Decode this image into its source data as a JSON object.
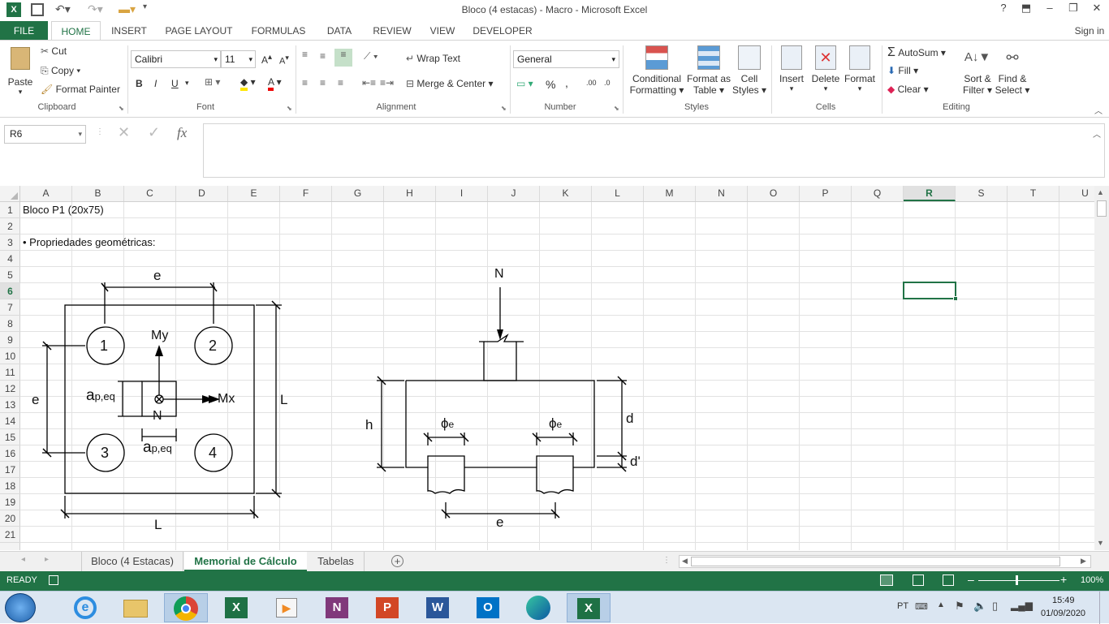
{
  "window": {
    "title": "Bloco (4 estacas) - Macro - Microsoft Excel",
    "help": "?",
    "sign_in": "Sign in"
  },
  "tabs": [
    "FILE",
    "HOME",
    "INSERT",
    "PAGE LAYOUT",
    "FORMULAS",
    "DATA",
    "REVIEW",
    "VIEW",
    "DEVELOPER"
  ],
  "ribbon": {
    "clipboard": {
      "paste": "Paste",
      "cut": "Cut",
      "copy": "Copy",
      "format_painter": "Format Painter",
      "label": "Clipboard"
    },
    "font": {
      "name": "Calibri",
      "size": "11",
      "label": "Font",
      "bold": "B",
      "italic": "I",
      "underline": "U"
    },
    "alignment": {
      "wrap": "Wrap Text",
      "merge": "Merge & Center",
      "label": "Alignment"
    },
    "number": {
      "format": "General",
      "label": "Number",
      "percent": "%",
      "comma": ","
    },
    "styles": {
      "conditional": "Conditional",
      "conditional2": "Formatting",
      "format_table": "Format as",
      "format_table2": "Table",
      "cell_styles": "Cell",
      "cell_styles2": "Styles",
      "label": "Styles"
    },
    "cells": {
      "insert": "Insert",
      "delete": "Delete",
      "format": "Format",
      "label": "Cells"
    },
    "editing": {
      "autosum": "AutoSum",
      "fill": "Fill",
      "clear": "Clear",
      "sort": "Sort &",
      "sort2": "Filter",
      "find": "Find &",
      "find2": "Select",
      "label": "Editing"
    }
  },
  "formula_bar": {
    "name_box": "R6",
    "fx": "fx",
    "value": ""
  },
  "columns": [
    "A",
    "B",
    "C",
    "D",
    "E",
    "F",
    "G",
    "H",
    "I",
    "J",
    "K",
    "L",
    "M",
    "N",
    "O",
    "P",
    "Q",
    "R",
    "S",
    "T",
    "U"
  ],
  "selected_column": "R",
  "rows": [
    "1",
    "2",
    "3",
    "4",
    "5",
    "6",
    "7",
    "8",
    "9",
    "10",
    "11",
    "12",
    "13",
    "14",
    "15",
    "16",
    "17",
    "18",
    "19",
    "20",
    "21"
  ],
  "selected_row": "6",
  "cells": {
    "A1": "Bloco P1 (20x75)",
    "A3": "• Propriedades geométricas:"
  },
  "drawing": {
    "plan": {
      "e_top": "e",
      "e_left": "e",
      "L_right": "L",
      "L_bottom": "L",
      "pile1": "1",
      "pile2": "2",
      "pile3": "3",
      "pile4": "4",
      "my": "My",
      "mx": "Mx",
      "n": "N",
      "ap_main": "a",
      "ap_sub": "p,eq"
    },
    "section": {
      "n": "N",
      "h": "h",
      "d": "d",
      "d_prime": "d'",
      "e": "e",
      "phi": "ϕ",
      "phi_sub": "e"
    }
  },
  "sheet_tabs": [
    "Bloco (4 Estacas)",
    "Memorial de Cálculo",
    "Tabelas"
  ],
  "active_sheet": "Memorial de Cálculo",
  "status": {
    "ready": "READY",
    "zoom": "100%"
  },
  "taskbar": {
    "lang": "PT",
    "time": "15:49",
    "date": "01/09/2020"
  },
  "icons": [
    "excel-app-icon",
    "save-icon",
    "undo-icon",
    "redo-icon",
    "open-folder-icon",
    "windows-start-icon",
    "ie-icon",
    "explorer-icon",
    "chrome-icon",
    "excel-icon",
    "media-player-icon",
    "onenote-icon",
    "powerpoint-icon",
    "word-icon",
    "outlook-icon",
    "edge-icon"
  ]
}
